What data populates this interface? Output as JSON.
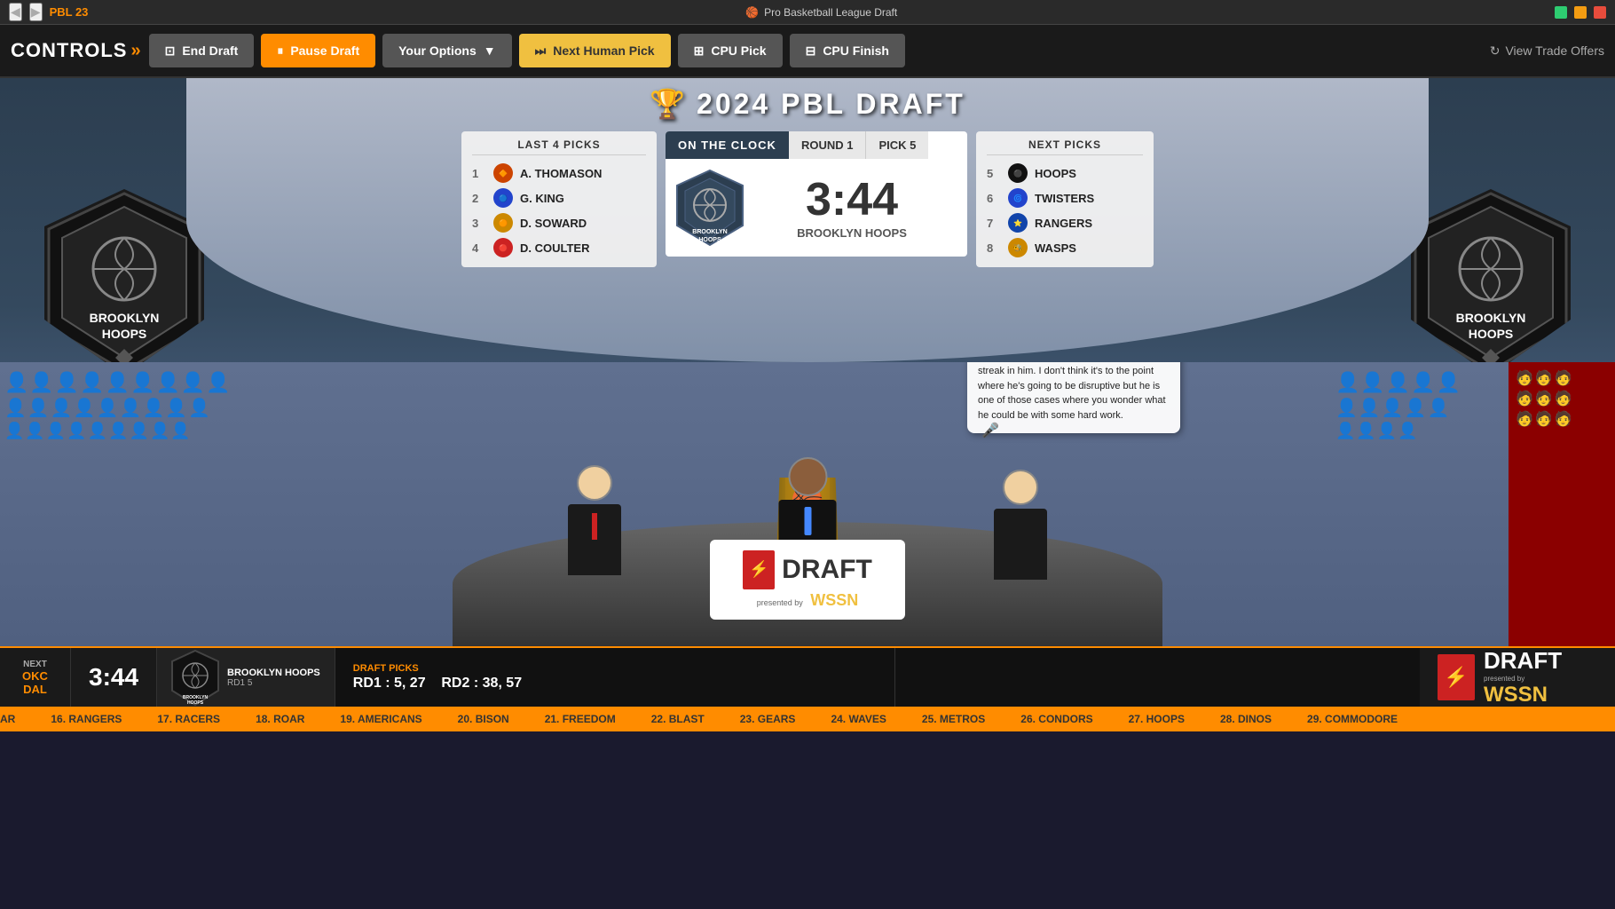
{
  "titlebar": {
    "back_icon": "◀",
    "forward_icon": "▶",
    "logo": "PBL 23",
    "title": "Pro Basketball League Draft",
    "title_icon": "🏀",
    "minimize": "—",
    "maximize": "□",
    "close": "✕"
  },
  "controls": {
    "label": "CONTROLS",
    "chevrons": "»",
    "end_draft": "End Draft",
    "pause_draft": "Pause Draft",
    "your_options": "Your Options",
    "next_human_pick": "Next Human Pick",
    "cpu_pick": "CPU Pick",
    "cpu_finish": "CPU Finish",
    "view_trade": "View Trade Offers",
    "refresh_icon": "↻"
  },
  "draft_title": "2024 PBL DRAFT",
  "last_picks": {
    "title": "LAST 4 PICKS",
    "picks": [
      {
        "num": 1,
        "name": "A. THOMASON",
        "team_color": "#cc4400"
      },
      {
        "num": 2,
        "name": "G. KING",
        "team_color": "#2244cc"
      },
      {
        "num": 3,
        "name": "D. SOWARD",
        "team_color": "#cc8800"
      },
      {
        "num": 4,
        "name": "D. COULTER",
        "team_color": "#cc2222"
      }
    ]
  },
  "clock": {
    "on_clock_label": "ON THE CLOCK",
    "round_label": "ROUND 1",
    "pick_label": "PICK 5",
    "time": "3:44",
    "team": "BROOKLYN HOOPS"
  },
  "next_picks": {
    "title": "NEXT PICKS",
    "picks": [
      {
        "num": 5,
        "name": "HOOPS",
        "team_color": "#111111"
      },
      {
        "num": 6,
        "name": "TWISTERS",
        "team_color": "#2244cc"
      },
      {
        "num": 7,
        "name": "RANGERS",
        "team_color": "#1144aa"
      },
      {
        "num": 8,
        "name": "WASPS",
        "team_color": "#cc8800"
      }
    ]
  },
  "team": {
    "name": "BROOKLYN",
    "subtitle": "HOOPS",
    "banner_left": "BROOKLYN HOO",
    "banner_right": "BROOKLYN",
    "shield_text": "BROOKLYN\nHOOPS"
  },
  "speech_bubble": {
    "text": "As much as his coach tried to avoid the subject, it has been an issue and it's believed that Coulter has a bit of a lazy streak in him. I don't think it's to the point where he's going to be disruptive but he is one of those cases where you wonder what he could be with some hard work.",
    "mic_icon": "🎤"
  },
  "status_bar": {
    "next_label": "NEXT",
    "team1": "OKC",
    "team2": "DAL",
    "timer": "3:44",
    "team_name": "BROOKLYN HOOPS",
    "rd_pick": "RD1   5",
    "hoops_label": "HOOPS",
    "draft_picks_title": "DRAFT PICKS",
    "draft_picks_rd1": "RD1 : 5, 27",
    "draft_picks_rd2": "RD2 : 38, 57"
  },
  "ticker": {
    "items": [
      "AR",
      "16. RANGERS",
      "17. RACERS",
      "18. ROAR",
      "19. AMERICANS",
      "20. BISON",
      "21. FREEDOM",
      "22. BLAST",
      "23. GEARS",
      "24. WAVES",
      "25. METROS",
      "26. CONDORS",
      "27. HOOPS",
      "28. DINOS",
      "29. COMMODORE"
    ]
  },
  "sponsor": {
    "draft_text": "DRAFT",
    "presented_by": "presented by",
    "network": "WSSN"
  },
  "colors": {
    "orange": "#ff8c00",
    "dark": "#1a1a1a",
    "arena_bg": "#4a6080",
    "shield_bg": "#111111"
  }
}
